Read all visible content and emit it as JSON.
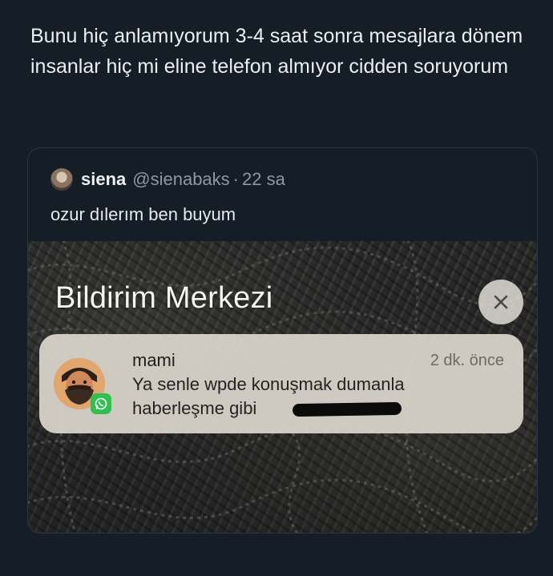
{
  "tweet": {
    "text": "Bunu hiç anlamıyorum 3-4 saat sonra mesajlara dönem insanlar hiç mi eline telefon almıyor cidden soruyorum"
  },
  "quote": {
    "name": "siena",
    "handle": "@sienabaks",
    "separator": "·",
    "time": "22 sa",
    "text": "ozur dılerım ben buyum"
  },
  "media": {
    "title": "Bildirim Merkezi",
    "close_icon": "close-icon",
    "notification": {
      "app": "mami",
      "time": "2 dk. önce",
      "body": "Ya senle wpde konuşmak dumanla haberleşme gibi",
      "badge_icon": "whatsapp-icon"
    }
  },
  "colors": {
    "background": "#151d27",
    "card_border": "#2c3640",
    "muted": "#8b98a5",
    "notification_bg": "#dcd8ce",
    "whatsapp_green": "#2fc04f"
  }
}
